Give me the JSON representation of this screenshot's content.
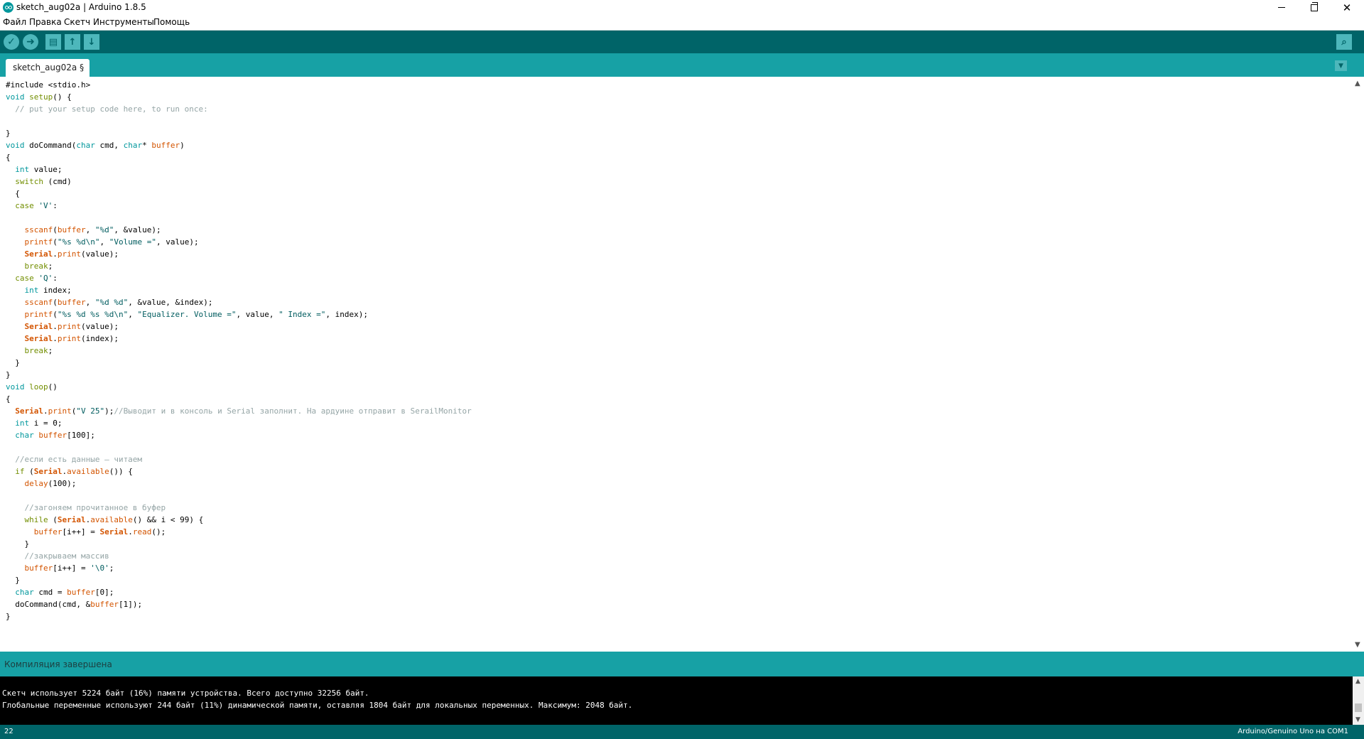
{
  "window": {
    "title": "sketch_aug02a | Arduino 1.8.5"
  },
  "menu": [
    "Файл",
    "Правка",
    "Скетч",
    "Инструменты",
    "Помощь"
  ],
  "toolbar": {
    "verify_glyph": "✓",
    "upload_glyph": "➜",
    "new_glyph": "▤",
    "open_glyph": "↑",
    "save_glyph": "↓",
    "serial_glyph": "⌕",
    "tab_menu_glyph": "▼"
  },
  "tab": {
    "label": "sketch_aug02a §"
  },
  "console": {
    "status": "Компиляция завершена",
    "lines": [
      "Скетч использует 5224 байт (16%) памяти устройства. Всего доступно 32256 байт.",
      "Глобальные переменные используют 244 байт (11%) динамической памяти, оставляя 1804 байт для локальных переменных. Максимум: 2048 байт."
    ]
  },
  "status": {
    "line": "22",
    "board": "Arduino/Genuino Uno на COM1"
  },
  "colors": {
    "toolbar": "#006468",
    "tabbar": "#17a1a5",
    "keyword": "#00979c",
    "function": "#d35400",
    "comment": "#95a5a6"
  },
  "code": [
    [
      {
        "t": "#include <stdio.h>"
      }
    ],
    [
      {
        "t": "void",
        "c": "kw"
      },
      {
        "t": " "
      },
      {
        "t": "setup",
        "c": "kw2"
      },
      {
        "t": "() {"
      }
    ],
    [
      {
        "t": "  // put your setup code here, to run once:",
        "c": "cm"
      }
    ],
    [
      {
        "t": ""
      }
    ],
    [
      {
        "t": "}"
      }
    ],
    [
      {
        "t": "void",
        "c": "kw"
      },
      {
        "t": " doCommand("
      },
      {
        "t": "char",
        "c": "kw"
      },
      {
        "t": " cmd, "
      },
      {
        "t": "char",
        "c": "kw"
      },
      {
        "t": "* "
      },
      {
        "t": "buffer",
        "c": "fn"
      },
      {
        "t": ")"
      }
    ],
    [
      {
        "t": "{"
      }
    ],
    [
      {
        "t": "  "
      },
      {
        "t": "int",
        "c": "kw"
      },
      {
        "t": " value;"
      }
    ],
    [
      {
        "t": "  "
      },
      {
        "t": "switch",
        "c": "kw2"
      },
      {
        "t": " (cmd)"
      }
    ],
    [
      {
        "t": "  {"
      }
    ],
    [
      {
        "t": "  "
      },
      {
        "t": "case",
        "c": "kw2"
      },
      {
        "t": " "
      },
      {
        "t": "'V'",
        "c": "str"
      },
      {
        "t": ":"
      }
    ],
    [
      {
        "t": ""
      }
    ],
    [
      {
        "t": "    "
      },
      {
        "t": "sscanf",
        "c": "fn"
      },
      {
        "t": "("
      },
      {
        "t": "buffer",
        "c": "fn"
      },
      {
        "t": ", "
      },
      {
        "t": "\"%d\"",
        "c": "str"
      },
      {
        "t": ", &value);"
      }
    ],
    [
      {
        "t": "    "
      },
      {
        "t": "printf",
        "c": "fn"
      },
      {
        "t": "("
      },
      {
        "t": "\"%s %d\\n\"",
        "c": "str"
      },
      {
        "t": ", "
      },
      {
        "t": "\"Volume =\"",
        "c": "str"
      },
      {
        "t": ", value);"
      }
    ],
    [
      {
        "t": "    "
      },
      {
        "t": "Serial",
        "c": "cls"
      },
      {
        "t": "."
      },
      {
        "t": "print",
        "c": "fn"
      },
      {
        "t": "(value);"
      }
    ],
    [
      {
        "t": "    "
      },
      {
        "t": "break",
        "c": "kw2"
      },
      {
        "t": ";"
      }
    ],
    [
      {
        "t": "  "
      },
      {
        "t": "case",
        "c": "kw2"
      },
      {
        "t": " "
      },
      {
        "t": "'Q'",
        "c": "str"
      },
      {
        "t": ":"
      }
    ],
    [
      {
        "t": "    "
      },
      {
        "t": "int",
        "c": "kw"
      },
      {
        "t": " index;"
      }
    ],
    [
      {
        "t": "    "
      },
      {
        "t": "sscanf",
        "c": "fn"
      },
      {
        "t": "("
      },
      {
        "t": "buffer",
        "c": "fn"
      },
      {
        "t": ", "
      },
      {
        "t": "\"%d %d\"",
        "c": "str"
      },
      {
        "t": ", &value, &index);"
      }
    ],
    [
      {
        "t": "    "
      },
      {
        "t": "printf",
        "c": "fn"
      },
      {
        "t": "("
      },
      {
        "t": "\"%s %d %s %d\\n\"",
        "c": "str"
      },
      {
        "t": ", "
      },
      {
        "t": "\"Equalizer. Volume =\"",
        "c": "str"
      },
      {
        "t": ", value, "
      },
      {
        "t": "\" Index =\"",
        "c": "str"
      },
      {
        "t": ", index);"
      }
    ],
    [
      {
        "t": "    "
      },
      {
        "t": "Serial",
        "c": "cls"
      },
      {
        "t": "."
      },
      {
        "t": "print",
        "c": "fn"
      },
      {
        "t": "(value);"
      }
    ],
    [
      {
        "t": "    "
      },
      {
        "t": "Serial",
        "c": "cls"
      },
      {
        "t": "."
      },
      {
        "t": "print",
        "c": "fn"
      },
      {
        "t": "(index);"
      }
    ],
    [
      {
        "t": "    "
      },
      {
        "t": "break",
        "c": "kw2"
      },
      {
        "t": ";"
      }
    ],
    [
      {
        "t": "  }"
      }
    ],
    [
      {
        "t": "}"
      }
    ],
    [
      {
        "t": "void",
        "c": "kw"
      },
      {
        "t": " "
      },
      {
        "t": "loop",
        "c": "kw2"
      },
      {
        "t": "()"
      }
    ],
    [
      {
        "t": "{"
      }
    ],
    [
      {
        "t": "  "
      },
      {
        "t": "Serial",
        "c": "cls"
      },
      {
        "t": "."
      },
      {
        "t": "print",
        "c": "fn"
      },
      {
        "t": "("
      },
      {
        "t": "\"V 25\"",
        "c": "str"
      },
      {
        "t": ");"
      },
      {
        "t": "//Выводит и в консоль и Serial заполнит. На ардуине отправит в SerailMonitor",
        "c": "cm"
      }
    ],
    [
      {
        "t": "  "
      },
      {
        "t": "int",
        "c": "kw"
      },
      {
        "t": " i = 0;"
      }
    ],
    [
      {
        "t": "  "
      },
      {
        "t": "char",
        "c": "kw"
      },
      {
        "t": " "
      },
      {
        "t": "buffer",
        "c": "fn"
      },
      {
        "t": "[100];"
      }
    ],
    [
      {
        "t": ""
      }
    ],
    [
      {
        "t": "  //если есть данные — читаем",
        "c": "cm"
      }
    ],
    [
      {
        "t": "  "
      },
      {
        "t": "if",
        "c": "kw2"
      },
      {
        "t": " ("
      },
      {
        "t": "Serial",
        "c": "cls"
      },
      {
        "t": "."
      },
      {
        "t": "available",
        "c": "fn"
      },
      {
        "t": "()) {"
      }
    ],
    [
      {
        "t": "    "
      },
      {
        "t": "delay",
        "c": "fn"
      },
      {
        "t": "(100);"
      }
    ],
    [
      {
        "t": ""
      }
    ],
    [
      {
        "t": "    //загоняем прочитанное в буфер",
        "c": "cm"
      }
    ],
    [
      {
        "t": "    "
      },
      {
        "t": "while",
        "c": "kw2"
      },
      {
        "t": " ("
      },
      {
        "t": "Serial",
        "c": "cls"
      },
      {
        "t": "."
      },
      {
        "t": "available",
        "c": "fn"
      },
      {
        "t": "() && i < 99) {"
      }
    ],
    [
      {
        "t": "      "
      },
      {
        "t": "buffer",
        "c": "fn"
      },
      {
        "t": "[i++] = "
      },
      {
        "t": "Serial",
        "c": "cls"
      },
      {
        "t": "."
      },
      {
        "t": "read",
        "c": "fn"
      },
      {
        "t": "();"
      }
    ],
    [
      {
        "t": "    }"
      }
    ],
    [
      {
        "t": "    //закрываем массив",
        "c": "cm"
      }
    ],
    [
      {
        "t": "    "
      },
      {
        "t": "buffer",
        "c": "fn"
      },
      {
        "t": "[i++] = "
      },
      {
        "t": "'\\0'",
        "c": "str"
      },
      {
        "t": ";"
      }
    ],
    [
      {
        "t": "  }"
      }
    ],
    [
      {
        "t": "  "
      },
      {
        "t": "char",
        "c": "kw"
      },
      {
        "t": " cmd = "
      },
      {
        "t": "buffer",
        "c": "fn"
      },
      {
        "t": "[0];"
      }
    ],
    [
      {
        "t": "  doCommand(cmd, &"
      },
      {
        "t": "buffer",
        "c": "fn"
      },
      {
        "t": "[1]);"
      }
    ],
    [
      {
        "t": "}"
      }
    ]
  ]
}
